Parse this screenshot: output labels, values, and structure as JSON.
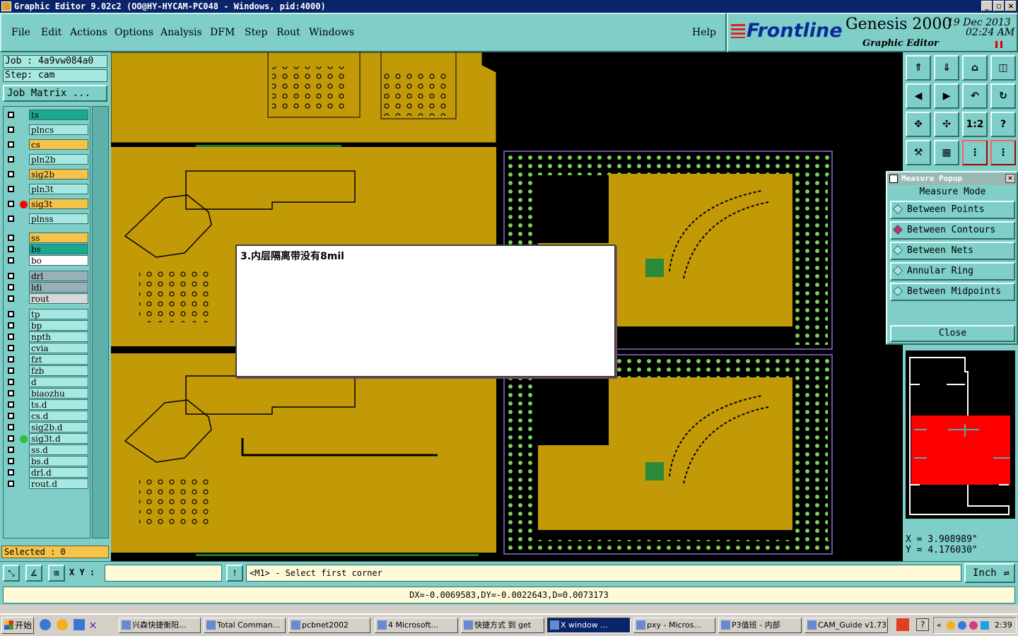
{
  "window": {
    "title": "Graphic Editor 9.02c2 (OO@HY-HYCAM-PC048 - Windows, pid:4000)"
  },
  "menu": {
    "file": "File",
    "edit": "Edit",
    "actions": "Actions",
    "options": "Options",
    "analysis": "Analysis",
    "dfm": "DFM",
    "step": "Step",
    "rout": "Rout",
    "windows": "Windows",
    "help": "Help"
  },
  "brand": {
    "logo": "Frontline",
    "product": "Genesis 2000",
    "subtitle": "Graphic Editor",
    "date": "19 Dec 2013",
    "time": "02:24 AM"
  },
  "job": {
    "job_label": "Job : 4a9vw084a0",
    "step_label": "Step: cam",
    "matrix_button": "Job Matrix ..."
  },
  "layers": [
    {
      "name": "ts",
      "color": "#1aa890"
    },
    {
      "name": "plncs",
      "color": "#a8e8e2"
    },
    {
      "name": "cs",
      "color": "#f5c24a"
    },
    {
      "name": "pln2b",
      "color": "#a8e8e2"
    },
    {
      "name": "sig2b",
      "color": "#f5c24a"
    },
    {
      "name": "pln3t",
      "color": "#a8e8e2"
    },
    {
      "name": "sig3t",
      "color": "#f5c24a",
      "active": true
    },
    {
      "name": "plnss",
      "color": "#a8e8e2"
    },
    {
      "name": "ss",
      "color": "#f5c24a"
    },
    {
      "name": "bs",
      "color": "#1aa890"
    },
    {
      "name": "bo",
      "color": "#ffffff"
    },
    {
      "name": "drl",
      "color": "#9ab0b8"
    },
    {
      "name": "ldi",
      "color": "#9ab0b8"
    },
    {
      "name": "rout",
      "color": "#d8d8d8"
    },
    {
      "name": "tp",
      "color": "#a8e8e2"
    },
    {
      "name": "bp",
      "color": "#a8e8e2"
    },
    {
      "name": "npth",
      "color": "#a8e8e2"
    },
    {
      "name": "cvia",
      "color": "#a8e8e2"
    },
    {
      "name": "fzt",
      "color": "#a8e8e2"
    },
    {
      "name": "fzb",
      "color": "#a8e8e2"
    },
    {
      "name": "d",
      "color": "#a8e8e2"
    },
    {
      "name": "biaozhu",
      "color": "#a8e8e2"
    },
    {
      "name": "ts.d",
      "color": "#a8e8e2"
    },
    {
      "name": "cs.d",
      "color": "#a8e8e2"
    },
    {
      "name": "sig2b.d",
      "color": "#a8e8e2"
    },
    {
      "name": "sig3t.d",
      "color": "#a8e8e2",
      "marker": "green"
    },
    {
      "name": "ss.d",
      "color": "#a8e8e2"
    },
    {
      "name": "bs.d",
      "color": "#a8e8e2"
    },
    {
      "name": "drl.d",
      "color": "#a8e8e2"
    },
    {
      "name": "rout.d",
      "color": "#a8e8e2"
    }
  ],
  "status": {
    "selected": "Selected : 0"
  },
  "dialog": {
    "message": "3.内层隔离带没有8mil"
  },
  "toolbar": {
    "one_to_two": "1:2",
    "help": "?"
  },
  "measure": {
    "title": "Measure Popup",
    "mode_label": "Measure Mode",
    "options": [
      "Between Points",
      "Between Contours",
      "Between Nets",
      "Annular Ring",
      "Between Midpoints"
    ],
    "selected": "Between Contours",
    "close": "Close"
  },
  "coords": {
    "x": "X = 3.908989\"",
    "y": "Y = 4.176030\""
  },
  "command": {
    "xy_label": "X Y :",
    "xy_value": "",
    "prompt": "<M1> - Select first corner",
    "unit": "Inch"
  },
  "measure_result": "DX=-0.0069583,DY=-0.0022643,D=0.0073173",
  "taskbar": {
    "start": "开始",
    "tasks": [
      "兴森快捷衡阳...",
      "Total Comman...",
      "pcbnet2002",
      "4 Microsoft...",
      "快捷方式 到 get",
      "X window ...",
      "pxy - Micros...",
      "P3值班 - 内部",
      "CAM_Guide v1.73"
    ],
    "clock": "2:39"
  },
  "colors": {
    "panel": "#7fcfc8",
    "copper": "#c29a08",
    "pad": "#7ad05a",
    "highlight": "#ff0000"
  }
}
